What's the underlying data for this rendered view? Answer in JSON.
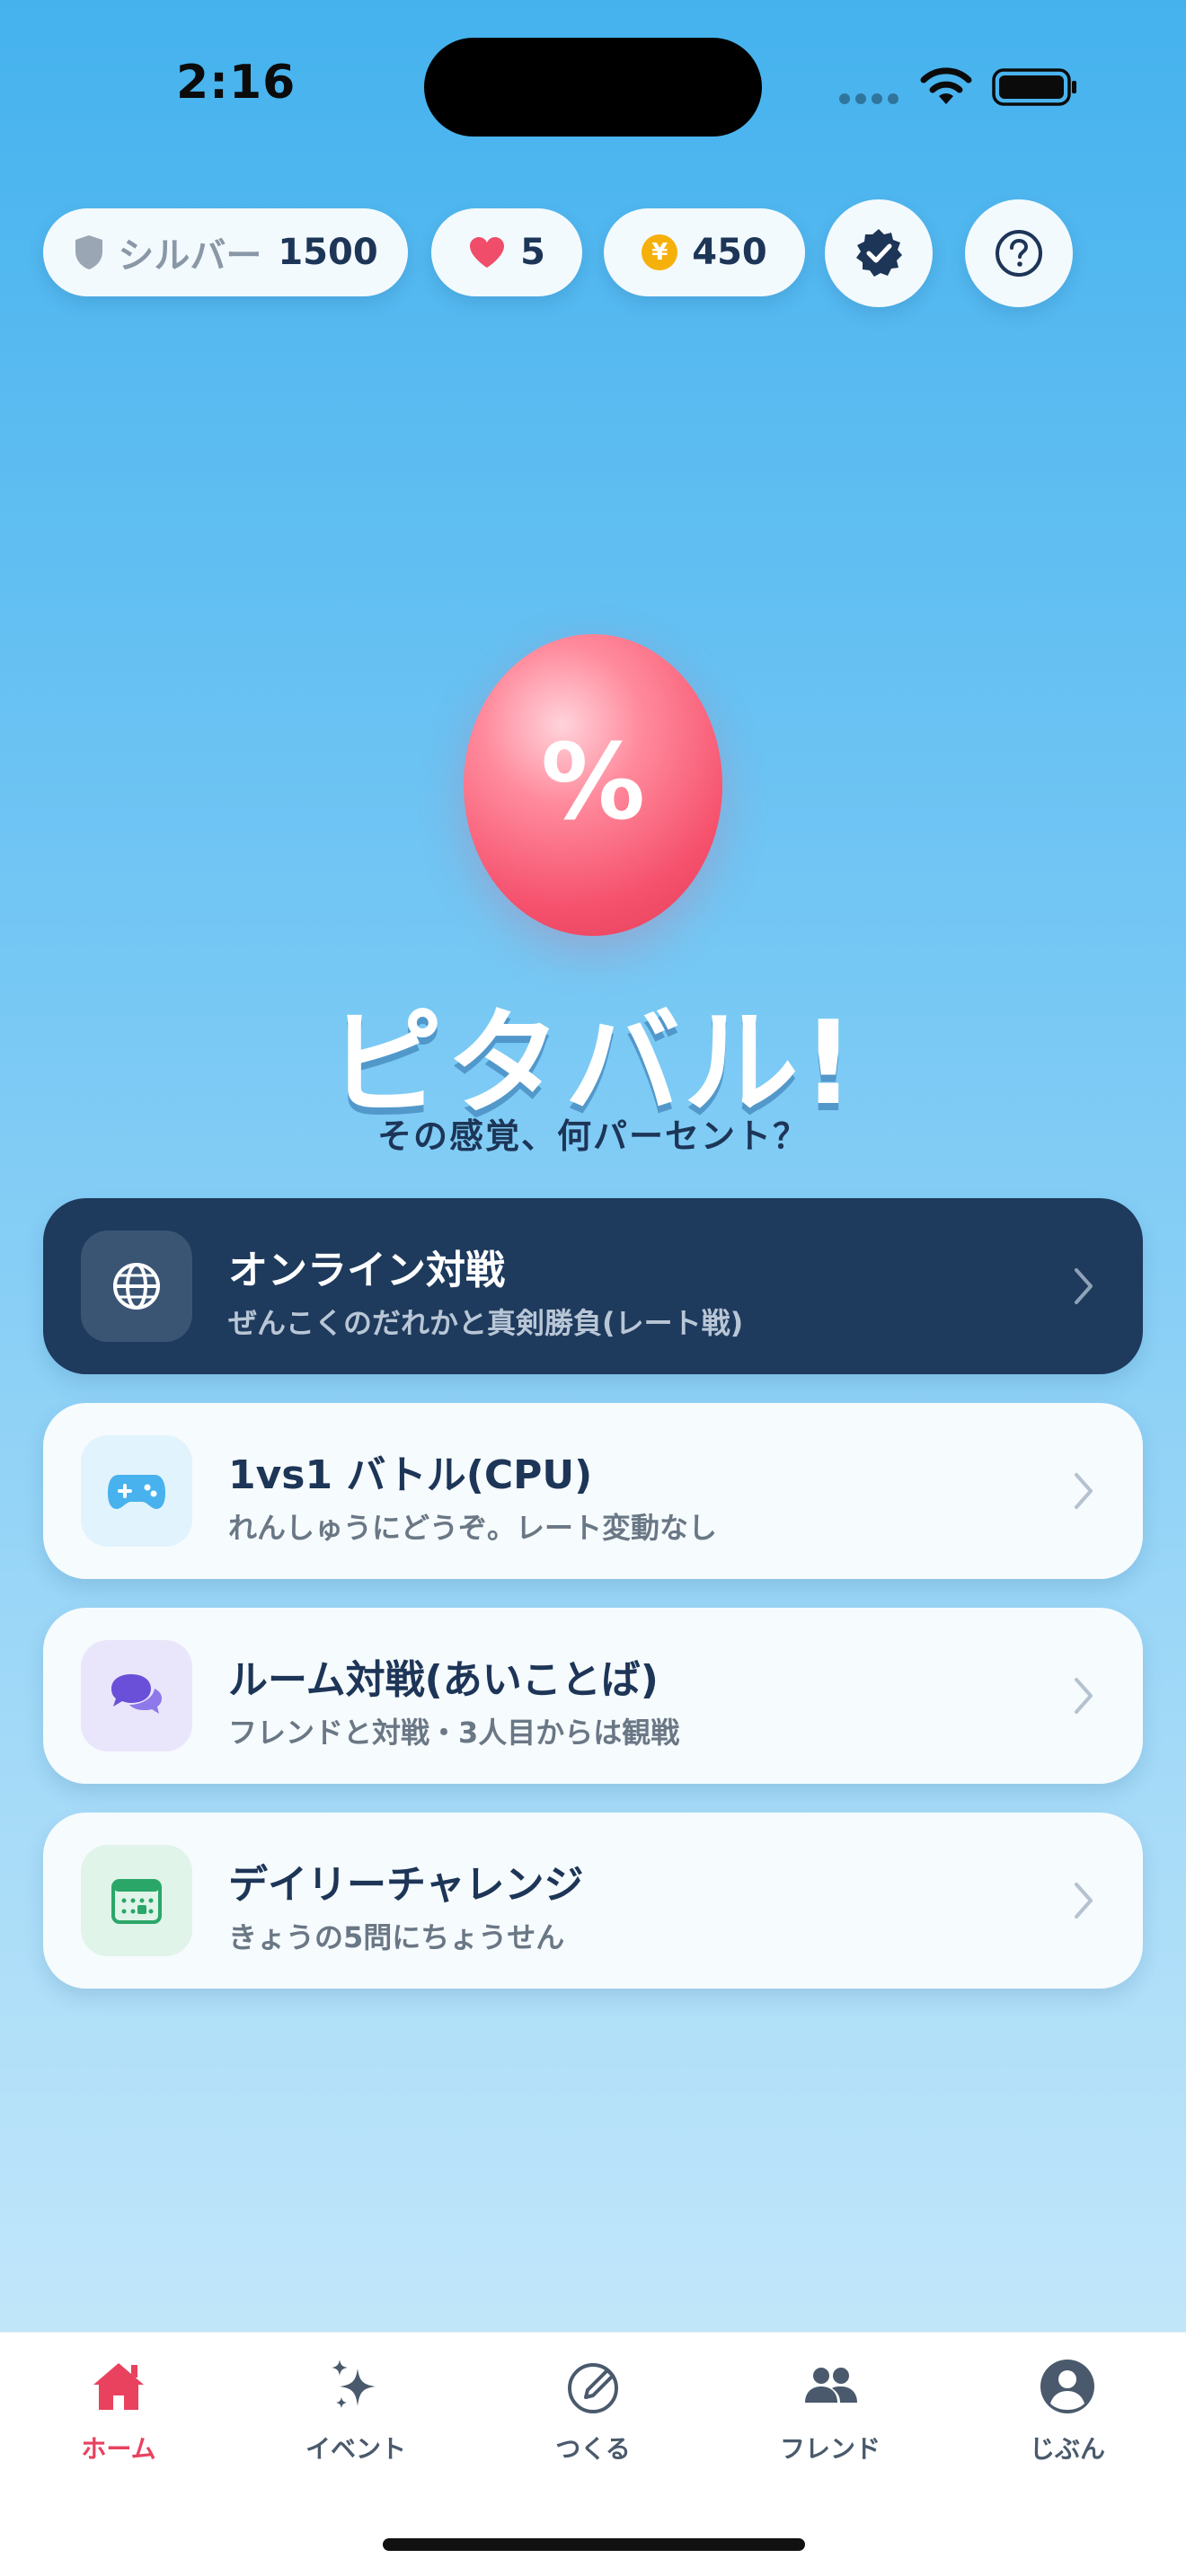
{
  "status_bar": {
    "time": "2:16"
  },
  "header": {
    "rank_label": "シルバー",
    "rank_points": "1500",
    "hearts": "5",
    "coins": "450",
    "coin_symbol": "¥"
  },
  "hero": {
    "balloon_symbol": "%",
    "title": "ピタバル!",
    "subtitle": "その感覚、何パーセント？"
  },
  "menu": [
    {
      "title": "オンライン対戦",
      "subtitle": "ぜんこくのだれかと真剣勝負(レート戦)",
      "icon": "globe-icon"
    },
    {
      "title": "1vs1 バトル(CPU)",
      "subtitle": "れんしゅうにどうぞ。レート変動なし",
      "icon": "gamepad-icon"
    },
    {
      "title": "ルーム対戦(あいことば)",
      "subtitle": "フレンドと対戦・3人目からは観戦",
      "icon": "chat-bubbles-icon"
    },
    {
      "title": "デイリーチャレンジ",
      "subtitle": "きょうの5問にちょうせん",
      "icon": "calendar-icon"
    }
  ],
  "tabs": [
    {
      "label": "ホーム",
      "icon": "home-icon",
      "active": true
    },
    {
      "label": "イベント",
      "icon": "sparkles-icon",
      "active": false
    },
    {
      "label": "つくる",
      "icon": "create-pencil-icon",
      "active": false
    },
    {
      "label": "フレンド",
      "icon": "friends-icon",
      "active": false
    },
    {
      "label": "じぶん",
      "icon": "profile-icon",
      "active": false
    }
  ],
  "colors": {
    "accent_red": "#e8425f",
    "navy": "#1d3557",
    "dark_card": "#1e3a5c",
    "coin_gold": "#f6b00c",
    "heart_red": "#f04d6a"
  }
}
